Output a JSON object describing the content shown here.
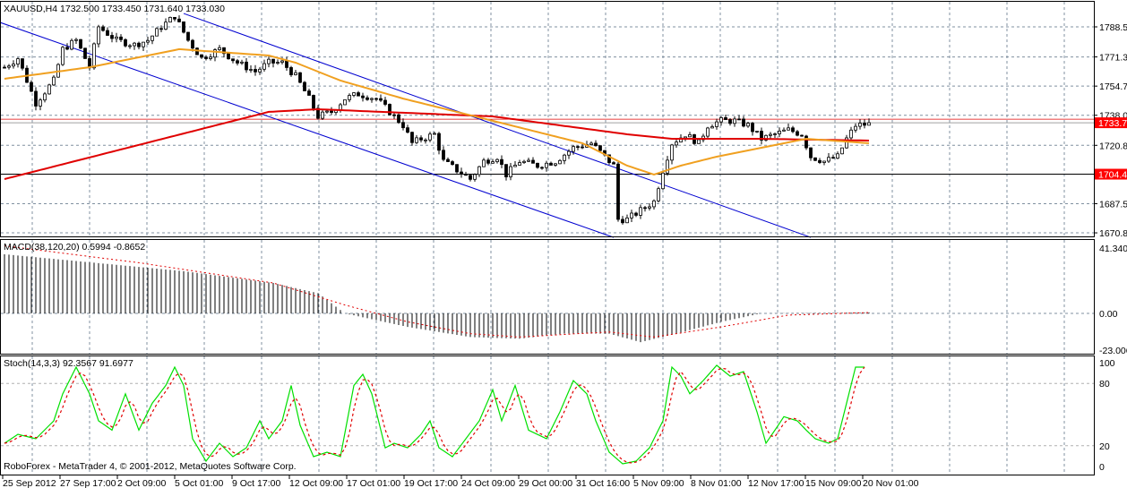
{
  "main": {
    "header": "XAUUSD,H4  1732.500 1733.450 1731.640 1733.030",
    "price_labels": [
      "1788.56",
      "1771.39",
      "1754.72",
      "1738.06",
      "1720.89",
      "1687.56",
      "1670.89"
    ],
    "price_label_values": [
      1788.56,
      1771.39,
      1754.72,
      1738.06,
      1720.89,
      1687.56,
      1670.89
    ],
    "hline_labels": [
      {
        "text": "1733.78",
        "value": 1733.78
      },
      {
        "text": "1704.41",
        "value": 1704.41
      }
    ],
    "copyright": "RoboForex - MetaTrader 4, © 2001-2012, MetaQuotes Software Corp."
  },
  "macd": {
    "header": "MACD(38,120,20) 0.5994 -0.8652",
    "labels": [
      "41.3402",
      "0.00",
      "-23.0061"
    ],
    "label_values": [
      41.3402,
      0,
      -23.0061
    ]
  },
  "stoch": {
    "header": "Stoch(14,3,3) 92.3567 91.6977",
    "labels": [
      "100",
      "80",
      "20",
      "0"
    ],
    "label_values": [
      100,
      80,
      20,
      0
    ]
  },
  "time_axis": [
    "25 Sep 2012",
    "27 Sep 17:00",
    "2 Oct 09:00",
    "5 Oct 01:00",
    "9 Oct 17:00",
    "12 Oct 09:00",
    "17 Oct 01:00",
    "19 Oct 17:00",
    "24 Oct 09:00",
    "29 Oct 00:00",
    "31 Oct 16:00",
    "5 Nov 09:00",
    "8 Nov 01:00",
    "12 Nov 17:00",
    "15 Nov 09:00",
    "20 Nov 01:00"
  ],
  "colors": {
    "ma_slow": "#e00000",
    "ma_fast": "#f0a020",
    "channel": "#0000d0",
    "stoch_main": "#00e000",
    "stoch_signal": "#e00000",
    "grid": "#8090a0",
    "label_bg": "#ff0000"
  },
  "chart_data": {
    "type": "candlestick",
    "symbol": "XAUUSD",
    "timeframe": "H4",
    "bars": 195,
    "ylim": [
      1666,
      1798
    ],
    "close_approx": [
      [
        0,
        1765.5
      ],
      [
        3,
        1770.7
      ],
      [
        7,
        1745.1
      ],
      [
        11,
        1757.9
      ],
      [
        13,
        1775.8
      ],
      [
        16,
        1780.9
      ],
      [
        19,
        1765.5
      ],
      [
        21,
        1788.6
      ],
      [
        25,
        1780.9
      ],
      [
        29,
        1778.3
      ],
      [
        32,
        1780.9
      ],
      [
        35,
        1788.6
      ],
      [
        38,
        1794.7
      ],
      [
        41,
        1780.9
      ],
      [
        44,
        1770.7
      ],
      [
        48,
        1775.8
      ],
      [
        52,
        1768.1
      ],
      [
        56,
        1763.0
      ],
      [
        59,
        1768.1
      ],
      [
        62,
        1768.1
      ],
      [
        65,
        1760.4
      ],
      [
        68,
        1747.6
      ],
      [
        70,
        1737.4
      ],
      [
        73,
        1740.0
      ],
      [
        76,
        1747.6
      ],
      [
        79,
        1750.2
      ],
      [
        83,
        1747.6
      ],
      [
        86,
        1740.0
      ],
      [
        89,
        1732.3
      ],
      [
        91,
        1722.1
      ],
      [
        93,
        1724.6
      ],
      [
        96,
        1727.2
      ],
      [
        98,
        1711.8
      ],
      [
        101,
        1706.7
      ],
      [
        104,
        1701.6
      ],
      [
        107,
        1711.8
      ],
      [
        110,
        1714.4
      ],
      [
        112,
        1704.2
      ],
      [
        115,
        1711.8
      ],
      [
        119,
        1709.3
      ],
      [
        123,
        1711.8
      ],
      [
        127,
        1719.5
      ],
      [
        131,
        1722.1
      ],
      [
        133,
        1717.0
      ],
      [
        136,
        1709.3
      ],
      [
        137,
        1678.6
      ],
      [
        139,
        1678.6
      ],
      [
        142,
        1683.7
      ],
      [
        145,
        1688.8
      ],
      [
        147,
        1706.7
      ],
      [
        149,
        1722.1
      ],
      [
        152,
        1727.2
      ],
      [
        155,
        1722.1
      ],
      [
        157,
        1732.3
      ],
      [
        160,
        1734.9
      ],
      [
        163,
        1734.9
      ],
      [
        166,
        1732.3
      ],
      [
        169,
        1724.6
      ],
      [
        172,
        1727.2
      ],
      [
        175,
        1729.7
      ],
      [
        178,
        1727.2
      ],
      [
        180,
        1714.4
      ],
      [
        183,
        1711.8
      ],
      [
        186,
        1714.4
      ],
      [
        188,
        1724.6
      ],
      [
        190,
        1732.3
      ],
      [
        193,
        1733.0
      ]
    ],
    "ma_slow": [
      [
        0,
        1701.6
      ],
      [
        59,
        1740.0
      ],
      [
        70,
        1741.5
      ],
      [
        109,
        1737.4
      ],
      [
        139,
        1727.2
      ],
      [
        149,
        1724.6
      ],
      [
        169,
        1724.6
      ],
      [
        193,
        1723.6
      ]
    ],
    "ma_fast": [
      [
        0,
        1758.9
      ],
      [
        19,
        1765.5
      ],
      [
        39,
        1775.8
      ],
      [
        59,
        1772.2
      ],
      [
        65,
        1768.1
      ],
      [
        75,
        1757.9
      ],
      [
        89,
        1747.6
      ],
      [
        109,
        1734.9
      ],
      [
        129,
        1722.1
      ],
      [
        139,
        1709.3
      ],
      [
        145,
        1704.2
      ],
      [
        151,
        1709.3
      ],
      [
        159,
        1714.4
      ],
      [
        169,
        1719.5
      ],
      [
        179,
        1724.6
      ],
      [
        193,
        1722.1
      ]
    ],
    "channel_lines": [
      [
        [
          -1,
          1791.1
        ],
        [
          136,
          1668.3
        ]
      ],
      [
        [
          40,
          1796.2
        ],
        [
          180,
          1668.3
        ]
      ]
    ],
    "macd_hist": [
      [
        0,
        35
      ],
      [
        20,
        30
      ],
      [
        40,
        25
      ],
      [
        60,
        18
      ],
      [
        70,
        12
      ],
      [
        76,
        0
      ],
      [
        90,
        -8
      ],
      [
        104,
        -14
      ],
      [
        115,
        -15
      ],
      [
        125,
        -12
      ],
      [
        135,
        -12
      ],
      [
        142,
        -17
      ],
      [
        150,
        -12
      ],
      [
        160,
        -5
      ],
      [
        169,
        0
      ],
      [
        193,
        0.5
      ]
    ],
    "macd_signal": [
      [
        0,
        40
      ],
      [
        30,
        30
      ],
      [
        60,
        18
      ],
      [
        76,
        5
      ],
      [
        90,
        -5
      ],
      [
        104,
        -12
      ],
      [
        115,
        -14
      ],
      [
        128,
        -12
      ],
      [
        135,
        -11
      ],
      [
        145,
        -14
      ],
      [
        160,
        -8
      ],
      [
        175,
        -1
      ],
      [
        193,
        0.5
      ]
    ],
    "macd_ylim": [
      -23.0061,
      41.3402
    ],
    "stoch_main": [
      [
        0,
        22.4
      ],
      [
        3,
        31
      ],
      [
        7,
        26.7
      ],
      [
        11,
        44
      ],
      [
        13,
        70
      ],
      [
        16,
        95.7
      ],
      [
        19,
        70
      ],
      [
        21,
        44
      ],
      [
        24,
        35
      ],
      [
        27,
        70
      ],
      [
        30,
        35
      ],
      [
        33,
        61
      ],
      [
        36,
        78
      ],
      [
        38,
        95.7
      ],
      [
        40,
        78
      ],
      [
        42,
        26.7
      ],
      [
        45,
        5.2
      ],
      [
        48,
        22.4
      ],
      [
        51,
        9.5
      ],
      [
        54,
        18
      ],
      [
        57,
        44
      ],
      [
        59,
        26.7
      ],
      [
        62,
        44
      ],
      [
        64,
        78
      ],
      [
        66,
        39.7
      ],
      [
        69,
        9.5
      ],
      [
        72,
        13.8
      ],
      [
        75,
        9.5
      ],
      [
        78,
        78
      ],
      [
        80,
        88.8
      ],
      [
        82,
        70
      ],
      [
        85,
        18
      ],
      [
        87,
        22.4
      ],
      [
        90,
        18
      ],
      [
        93,
        31
      ],
      [
        95,
        44
      ],
      [
        97,
        18
      ],
      [
        100,
        9.5
      ],
      [
        103,
        26.7
      ],
      [
        106,
        44
      ],
      [
        109,
        74
      ],
      [
        111,
        44
      ],
      [
        114,
        78
      ],
      [
        117,
        35
      ],
      [
        121,
        26.7
      ],
      [
        124,
        52.6
      ],
      [
        127,
        82.8
      ],
      [
        130,
        70
      ],
      [
        132,
        44
      ],
      [
        135,
        13.8
      ],
      [
        138,
        2.6
      ],
      [
        141,
        5.2
      ],
      [
        144,
        18
      ],
      [
        147,
        44
      ],
      [
        149,
        95.7
      ],
      [
        151,
        87
      ],
      [
        153,
        70
      ],
      [
        156,
        82.8
      ],
      [
        159,
        97.4
      ],
      [
        162,
        87
      ],
      [
        165,
        91.4
      ],
      [
        168,
        52.6
      ],
      [
        170,
        22.4
      ],
      [
        172,
        35
      ],
      [
        174,
        48
      ],
      [
        177,
        44
      ],
      [
        179,
        35
      ],
      [
        181,
        26.7
      ],
      [
        184,
        22.4
      ],
      [
        186,
        26.7
      ],
      [
        188,
        61
      ],
      [
        190,
        95.7
      ],
      [
        192,
        95.7
      ]
    ],
    "stoch_ylim": [
      0,
      100
    ]
  }
}
